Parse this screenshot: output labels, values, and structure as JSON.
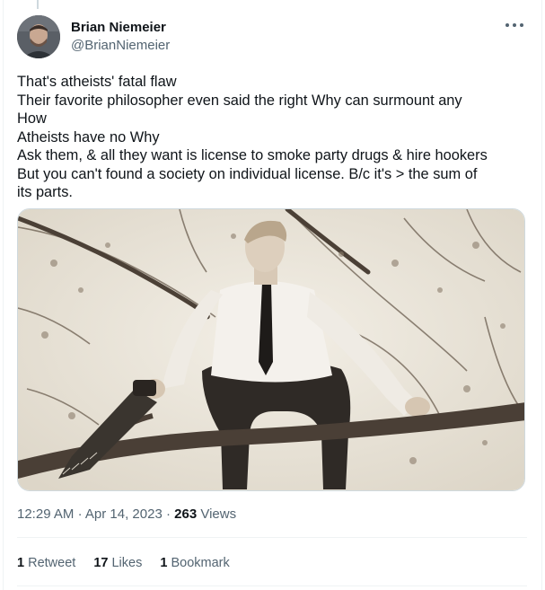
{
  "author": {
    "display_name": "Brian Niemeier",
    "handle": "@BrianNiemeier",
    "avatar_icon": "user-avatar"
  },
  "tweet": {
    "lines": [
      "That's atheists' fatal flaw",
      "Their favorite philosopher even said the right Why can surmount any",
      "How",
      "Atheists have no Why",
      "Ask them, & all they want is license to smoke party drugs & hire hookers",
      "But you can't found a society on individual license. B/c it's > the sum of",
      "its parts."
    ]
  },
  "meta": {
    "time": "12:29 AM",
    "separator": "·",
    "date": "Apr 14, 2023",
    "views_count": "263",
    "views_label": "Views"
  },
  "stats": {
    "retweets_count": "1",
    "retweets_label": "Retweet",
    "likes_count": "17",
    "likes_label": "Likes",
    "bookmarks_count": "1",
    "bookmarks_label": "Bookmark"
  },
  "colors": {
    "text_primary": "#0f1419",
    "text_secondary": "#536471",
    "border": "#eff3f4",
    "photo_tint": "#e6e1d6"
  }
}
